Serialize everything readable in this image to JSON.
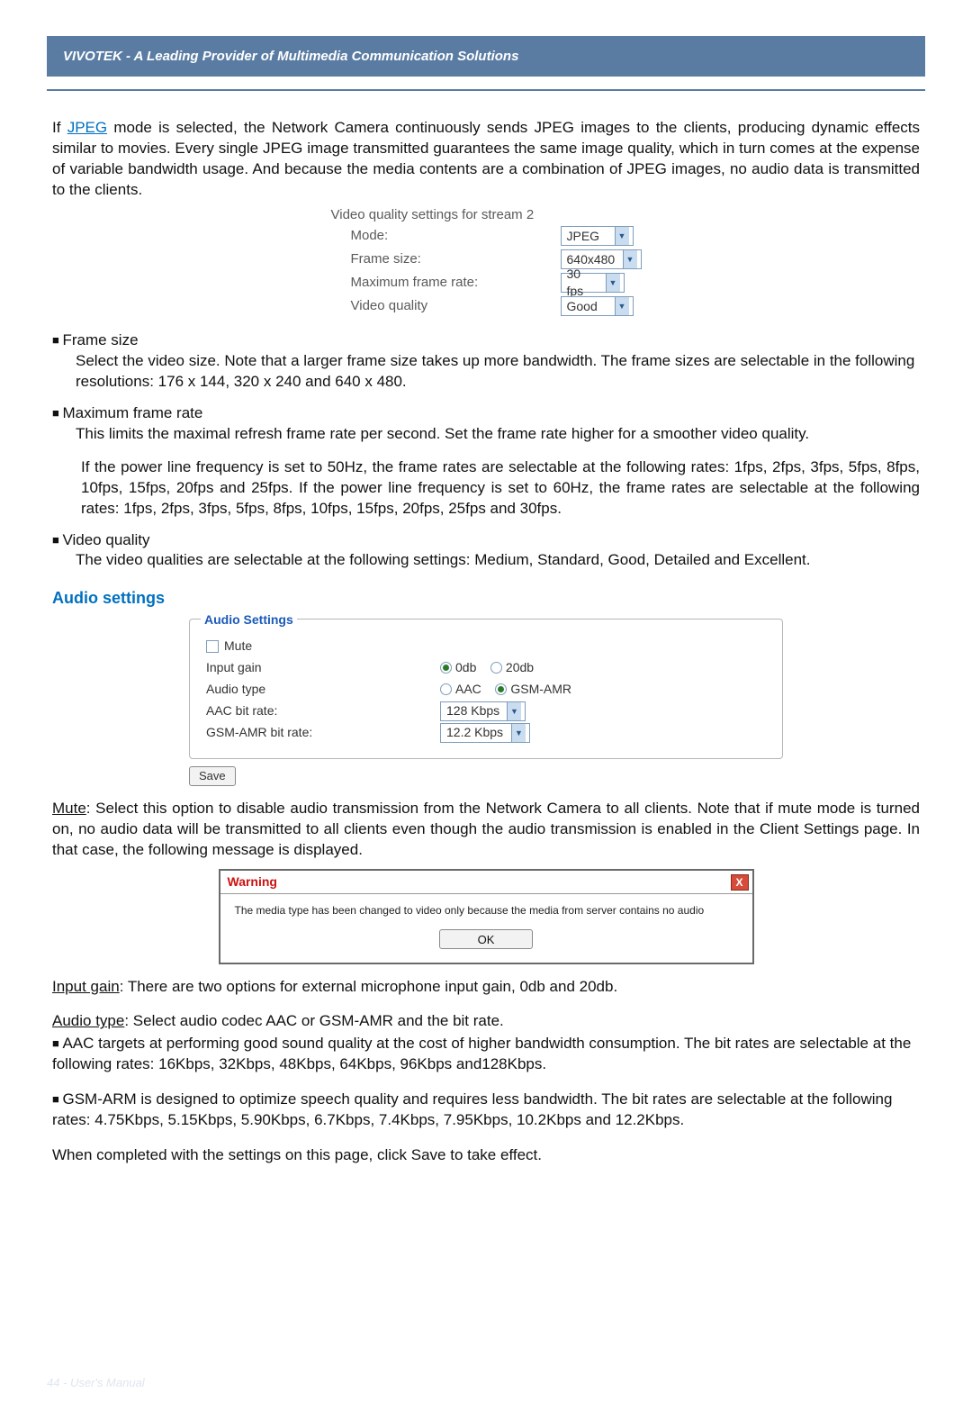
{
  "header": {
    "title": "VIVOTEK - A Leading Provider of Multimedia Communication Solutions"
  },
  "intro": {
    "prefix": "If ",
    "link": "JPEG",
    "body": " mode is selected, the Network Camera continuously sends JPEG images to the clients, producing dynamic effects similar to movies. Every single JPEG image transmitted guarantees the same image quality, which in turn comes at the expense of variable bandwidth usage. And because the media contents are a combination of JPEG images, no audio data is transmitted to the clients."
  },
  "video_quality": {
    "heading": "Video quality settings for stream 2",
    "rows": [
      {
        "label": "Mode:",
        "value": "JPEG"
      },
      {
        "label": "Frame size:",
        "value": "640x480"
      },
      {
        "label": "Maximum frame rate:",
        "value": "30 fps"
      },
      {
        "label": "Video quality",
        "value": "Good"
      }
    ]
  },
  "frame_size": {
    "title": "Frame size",
    "body": "Select the video size. Note that a larger frame size takes up more bandwidth. The frame sizes are selectable in the following resolutions: 176 x 144, 320 x 240 and 640 x 480."
  },
  "max_frame_rate": {
    "title": "Maximum frame rate",
    "body1": "This limits the maximal refresh frame rate per second. Set the frame rate higher for a smoother video quality.",
    "body2": "If the power line frequency is set to 50Hz, the frame rates are selectable at the following rates: 1fps, 2fps, 3fps, 5fps, 8fps, 10fps, 15fps, 20fps and 25fps. If the power line frequency is set to 60Hz, the frame rates are selectable at the following rates: 1fps, 2fps, 3fps, 5fps, 8fps, 10fps, 15fps, 20fps, 25fps and 30fps."
  },
  "video_quality_item": {
    "title": "Video quality",
    "body": "The video qualities are selectable at the following settings: Medium, Standard, Good, Detailed and Excellent."
  },
  "audio_section": {
    "heading": "Audio settings"
  },
  "audio_panel": {
    "legend": "Audio Settings",
    "mute_label": "Mute",
    "rows": {
      "input_gain_label": "Input gain",
      "input_gain_opt1": "0db",
      "input_gain_opt2": "20db",
      "audio_type_label": "Audio type",
      "audio_type_opt1": "AAC",
      "audio_type_opt2": "GSM-AMR",
      "aac_label": "AAC bit rate:",
      "aac_value": "128 Kbps",
      "gsm_label": "GSM-AMR bit rate:",
      "gsm_value": "12.2 Kbps"
    },
    "save_label": "Save"
  },
  "mute_para": {
    "lead": "Mute",
    "body": ": Select this option to disable audio transmission from the Network Camera to all clients. Note that if mute mode is turned on, no audio data will be transmitted to all clients even though the audio transmission is enabled in the Client Settings page. In that case, the following message is displayed."
  },
  "warning": {
    "title": "Warning",
    "close": "X",
    "message": "The media type has been changed to video only because the media from server contains no audio",
    "ok": "OK"
  },
  "input_gain_para": {
    "lead": "Input gain",
    "body": ": There are two options for external microphone input gain, 0db and 20db."
  },
  "audio_type_para": {
    "lead": "Audio type",
    "body": ": Select audio codec AAC or GSM-AMR and the bit rate."
  },
  "aac_bullet": "AAC targets at performing good sound quality at the cost of higher bandwidth consumption. The bit rates are selectable at the following rates: 16Kbps, 32Kbps, 48Kbps, 64Kbps, 96Kbps and128Kbps.",
  "gsm_bullet": "GSM-ARM is designed to optimize speech quality and requires less bandwidth. The bit rates are selectable at the following rates: 4.75Kbps, 5.15Kbps, 5.90Kbps, 6.7Kbps, 7.4Kbps, 7.95Kbps, 10.2Kbps and 12.2Kbps.",
  "closing": "When completed with the settings on this page, click Save to take effect.",
  "footer": "44 - User's Manual"
}
